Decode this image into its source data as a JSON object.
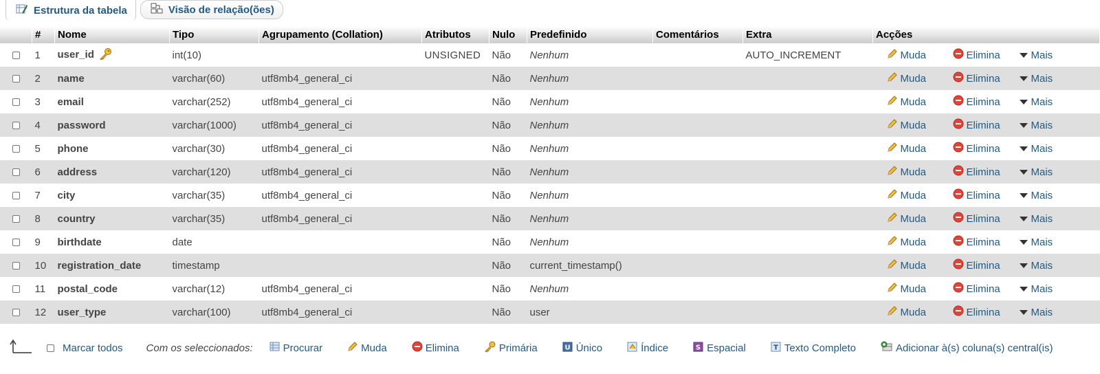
{
  "tabs": [
    {
      "label": "Estrutura da tabela",
      "icon": "table-structure-icon"
    },
    {
      "label": "Visão de relação(ões)",
      "icon": "relation-view-icon"
    }
  ],
  "columns": [
    "#",
    "Nome",
    "Tipo",
    "Agrupamento (Collation)",
    "Atributos",
    "Nulo",
    "Predefinido",
    "Comentários",
    "Extra",
    "Acções"
  ],
  "actions": {
    "change": "Muda",
    "drop": "Elimina",
    "more": "Mais"
  },
  "rows": [
    {
      "num": "1",
      "name": "user_id",
      "type": "int(10)",
      "collation": "",
      "attributes": "UNSIGNED",
      "null": "Não",
      "default": "Nenhum",
      "default_italic": true,
      "comments": "",
      "extra": "AUTO_INCREMENT",
      "primary": true
    },
    {
      "num": "2",
      "name": "name",
      "type": "varchar(60)",
      "collation": "utf8mb4_general_ci",
      "attributes": "",
      "null": "Não",
      "default": "Nenhum",
      "default_italic": true,
      "comments": "",
      "extra": ""
    },
    {
      "num": "3",
      "name": "email",
      "type": "varchar(252)",
      "collation": "utf8mb4_general_ci",
      "attributes": "",
      "null": "Não",
      "default": "Nenhum",
      "default_italic": true,
      "comments": "",
      "extra": ""
    },
    {
      "num": "4",
      "name": "password",
      "type": "varchar(1000)",
      "collation": "utf8mb4_general_ci",
      "attributes": "",
      "null": "Não",
      "default": "Nenhum",
      "default_italic": true,
      "comments": "",
      "extra": ""
    },
    {
      "num": "5",
      "name": "phone",
      "type": "varchar(30)",
      "collation": "utf8mb4_general_ci",
      "attributes": "",
      "null": "Não",
      "default": "Nenhum",
      "default_italic": true,
      "comments": "",
      "extra": ""
    },
    {
      "num": "6",
      "name": "address",
      "type": "varchar(120)",
      "collation": "utf8mb4_general_ci",
      "attributes": "",
      "null": "Não",
      "default": "Nenhum",
      "default_italic": true,
      "comments": "",
      "extra": ""
    },
    {
      "num": "7",
      "name": "city",
      "type": "varchar(35)",
      "collation": "utf8mb4_general_ci",
      "attributes": "",
      "null": "Não",
      "default": "Nenhum",
      "default_italic": true,
      "comments": "",
      "extra": ""
    },
    {
      "num": "8",
      "name": "country",
      "type": "varchar(35)",
      "collation": "utf8mb4_general_ci",
      "attributes": "",
      "null": "Não",
      "default": "Nenhum",
      "default_italic": true,
      "comments": "",
      "extra": ""
    },
    {
      "num": "9",
      "name": "birthdate",
      "type": "date",
      "collation": "",
      "attributes": "",
      "null": "Não",
      "default": "Nenhum",
      "default_italic": true,
      "comments": "",
      "extra": ""
    },
    {
      "num": "10",
      "name": "registration_date",
      "type": "timestamp",
      "collation": "",
      "attributes": "",
      "null": "Não",
      "default": "current_timestamp()",
      "default_italic": false,
      "comments": "",
      "extra": ""
    },
    {
      "num": "11",
      "name": "postal_code",
      "type": "varchar(12)",
      "collation": "utf8mb4_general_ci",
      "attributes": "",
      "null": "Não",
      "default": "Nenhum",
      "default_italic": true,
      "comments": "",
      "extra": ""
    },
    {
      "num": "12",
      "name": "user_type",
      "type": "varchar(100)",
      "collation": "utf8mb4_general_ci",
      "attributes": "",
      "null": "Não",
      "default": "user",
      "default_italic": false,
      "comments": "",
      "extra": ""
    }
  ],
  "footer": {
    "check_all": "Marcar todos",
    "with_selected": "Com os seleccionados:",
    "browse": "Procurar",
    "change": "Muda",
    "drop": "Elimina",
    "primary": "Primária",
    "unique": "Único",
    "index": "Índice",
    "spatial": "Espacial",
    "fulltext": "Texto Completo",
    "central": "Adicionar à(s) coluna(s) central(is)"
  },
  "colors": {
    "link": "#235a81",
    "row_alt": "#dfdfdf"
  }
}
